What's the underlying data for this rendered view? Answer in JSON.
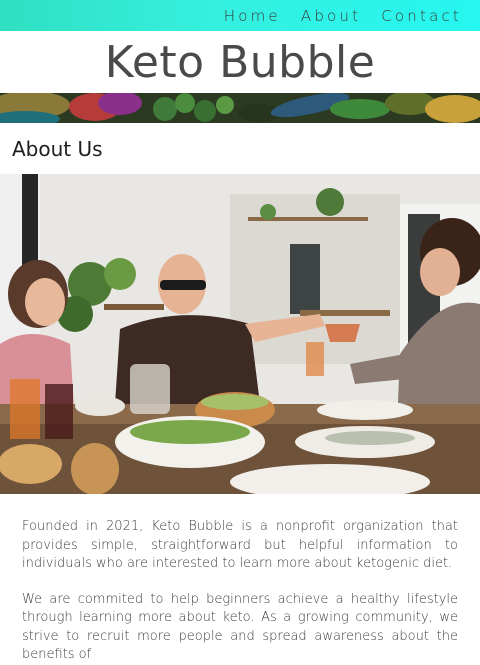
{
  "nav": {
    "links": [
      "Home",
      "About",
      "Contact"
    ]
  },
  "brand": {
    "title": "Keto Bubble"
  },
  "about": {
    "heading": "About Us",
    "paragraphs": [
      "Founded in 2021, Keto Bubble is a nonprofit organization that provides simple, straightforward but helpful information to individuals who are interested to learn more about ketogenic diet.",
      "We are commited to help beginners achieve a healthy lifestyle through learning more about keto. As a growing community, we strive to recruit more people and spread awareness about the benefits of"
    ]
  },
  "colors": {
    "nav_gradient_start": "#2fe0c2",
    "nav_gradient_end": "#26f7f0",
    "brand_text": "#4a4a4a"
  }
}
